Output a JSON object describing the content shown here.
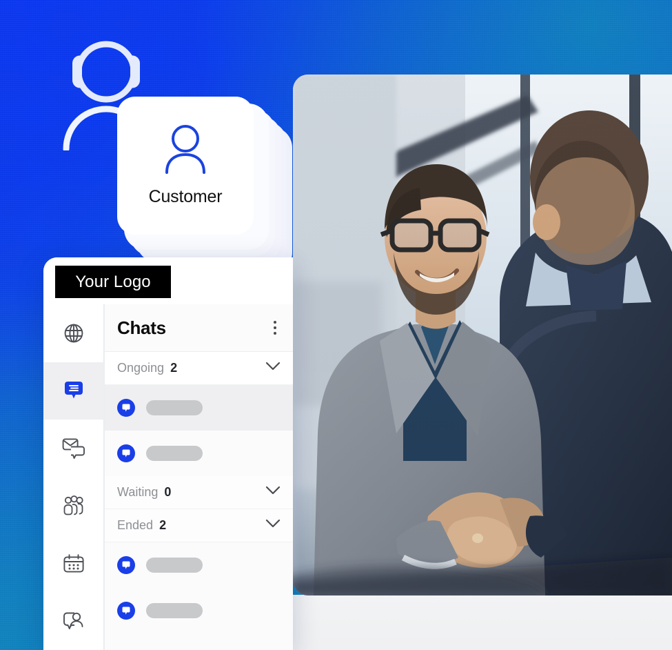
{
  "background": {
    "gradient_from": "#0D3FE9",
    "gradient_to": "#1189BD",
    "accent_blue": "#1A3EE8"
  },
  "hero": {
    "agent_icon": "headset-agent-icon",
    "customer_card": {
      "icon": "person-outline-icon",
      "label": "Customer",
      "stack_count": 6
    },
    "photo": {
      "alt": "two businessmen shaking hands in a modern office"
    }
  },
  "app": {
    "logo": {
      "label": "Your Logo",
      "bg": "#000000",
      "fg": "#FFFFFF"
    },
    "rail": {
      "items": [
        {
          "name": "globe-icon",
          "label": "Website",
          "active": false
        },
        {
          "name": "chat-icon",
          "label": "Chats",
          "active": true
        },
        {
          "name": "mail-chat-icon",
          "label": "Inbox",
          "active": false
        },
        {
          "name": "people-group-icon",
          "label": "Teams",
          "active": false
        },
        {
          "name": "calendar-icon",
          "label": "Schedule",
          "active": false
        },
        {
          "name": "visitor-chat-icon",
          "label": "Visitors",
          "active": false
        }
      ]
    },
    "chats": {
      "title": "Chats",
      "menu_icon": "kebab-menu-icon",
      "groups": [
        {
          "label": "Ongoing",
          "count": "2",
          "expanded": true,
          "rows": [
            {
              "icon": "chat-bubble-icon",
              "selected": true
            },
            {
              "icon": "chat-bubble-icon",
              "selected": false
            }
          ]
        },
        {
          "label": "Waiting",
          "count": "0",
          "expanded": false,
          "rows": []
        },
        {
          "label": "Ended",
          "count": "2",
          "expanded": true,
          "rows": [
            {
              "icon": "chat-bubble-icon",
              "selected": false
            },
            {
              "icon": "chat-bubble-icon",
              "selected": false
            }
          ]
        }
      ]
    }
  }
}
